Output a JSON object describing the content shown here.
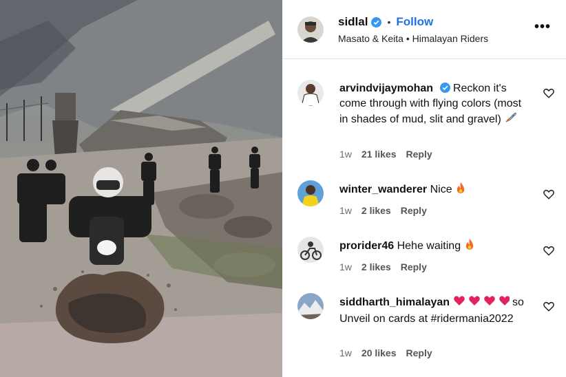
{
  "post": {
    "username": "sidlal",
    "follow_label": "Follow",
    "separator": "•",
    "subtitle": "Masato & Keita • Himalayan Riders",
    "more_label": "•••"
  },
  "comments": [
    {
      "username": "arvindvijaymohan",
      "verified": true,
      "text": "Reckon it's come through with flying colors (most in shades of mud, slit and gravel)",
      "emoji": "rocket-icon",
      "time": "1w",
      "likes": "21 likes",
      "reply": "Reply"
    },
    {
      "username": "winter_wanderer",
      "text": "Nice",
      "emoji": "fire-icon",
      "time": "1w",
      "likes": "2 likes",
      "reply": "Reply"
    },
    {
      "username": "prorider46",
      "text": "Hehe waiting",
      "emoji": "fire-icon",
      "time": "1w",
      "likes": "2 likes",
      "reply": "Reply"
    },
    {
      "username": "siddharth_himalayan",
      "text": "so Unveil on cards at #ridermania2022",
      "emoji": "red-hearts-icon",
      "time": "1w",
      "likes": "20 likes",
      "reply": "Reply"
    }
  ],
  "colors": {
    "accent": "#1b74e4",
    "verified": "#3897f0",
    "muted_text": "#6b6b6b",
    "heart_red": "#e0245e",
    "fire_orange": "#f46a1b"
  }
}
